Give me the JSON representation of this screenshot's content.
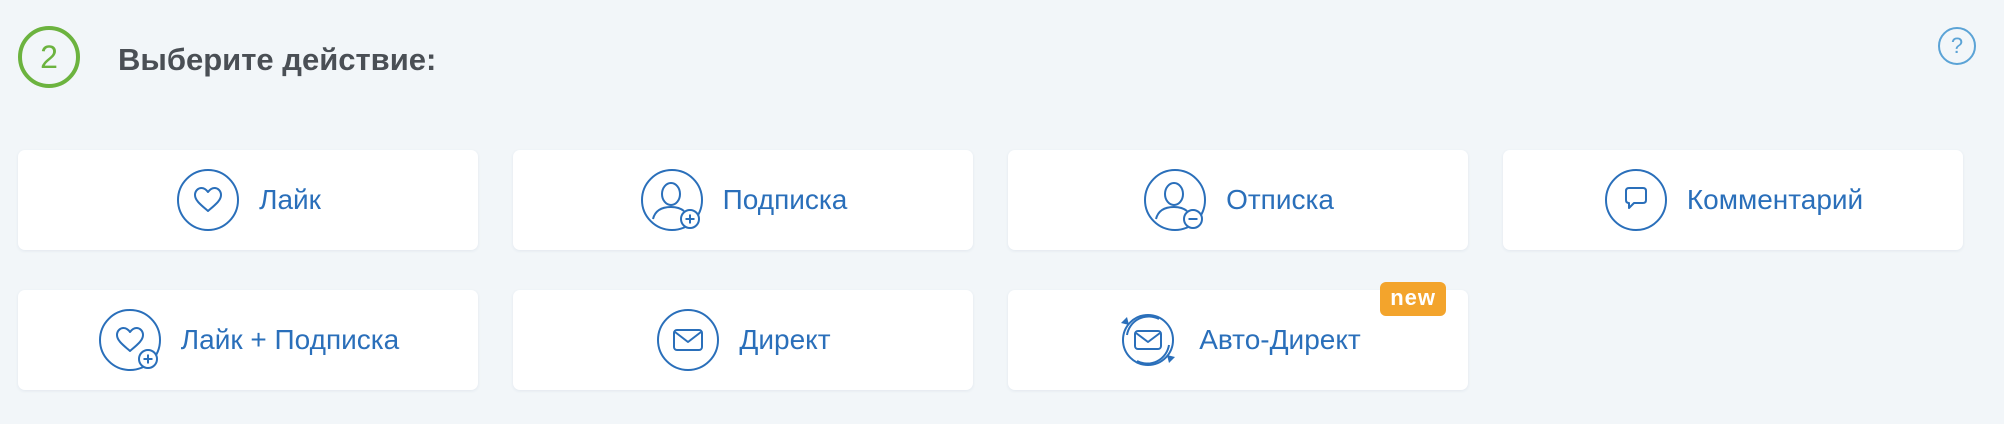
{
  "step": {
    "number": "2",
    "title": "Выберите действие:"
  },
  "help": {
    "label": "?"
  },
  "actions": [
    {
      "label": "Лайк",
      "icon": "heart-icon"
    },
    {
      "label": "Подписка",
      "icon": "user-add-icon"
    },
    {
      "label": "Отписка",
      "icon": "user-remove-icon"
    },
    {
      "label": "Комментарий",
      "icon": "comment-icon"
    },
    {
      "label": "Лайк + Подписка",
      "icon": "heart-add-icon"
    },
    {
      "label": "Директ",
      "icon": "envelope-icon"
    },
    {
      "label": "Авто-Директ",
      "icon": "auto-envelope-icon",
      "badge": "new"
    }
  ],
  "colors": {
    "accent_blue": "#2a6fba",
    "step_green": "#6cb33f",
    "badge_orange": "#f3a42c",
    "background": "#f2f6f9"
  }
}
